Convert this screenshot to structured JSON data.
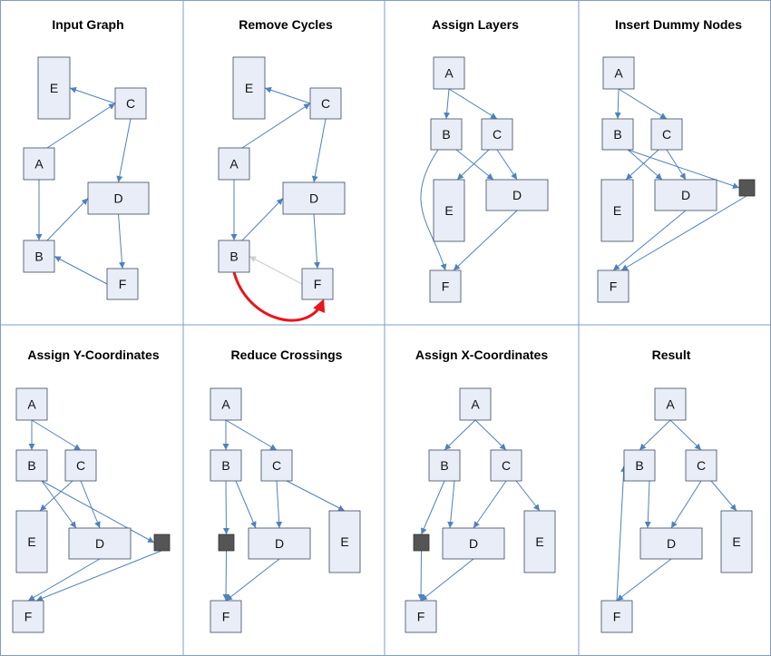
{
  "colors": {
    "panel_border": "#7f9fc6",
    "node_fill": "#e8edf7",
    "node_stroke": "#3b4a5e",
    "dummy_fill": "#555555",
    "edge": "#4f81bd",
    "edge_faint": "#c8ccd2",
    "edge_reversed": "#e8151b"
  },
  "panels": [
    {
      "title": "Input Graph"
    },
    {
      "title": "Remove Cycles"
    },
    {
      "title": "Assign Layers"
    },
    {
      "title": "Insert Dummy Nodes"
    },
    {
      "title": "Assign Y-Coordinates"
    },
    {
      "title": "Reduce Crossings"
    },
    {
      "title": "Assign X-Coordinates"
    },
    {
      "title": "Result"
    }
  ],
  "node_labels": [
    "A",
    "B",
    "C",
    "D",
    "E",
    "F"
  ]
}
